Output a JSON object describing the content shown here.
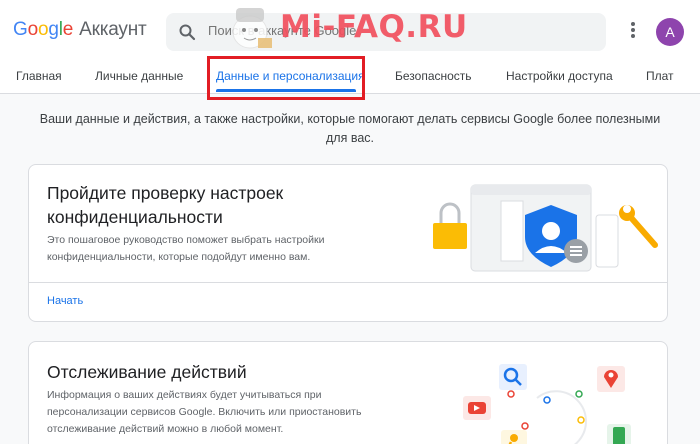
{
  "header": {
    "logo_letters": [
      "G",
      "o",
      "o",
      "g",
      "l",
      "e"
    ],
    "product": "Аккаунт",
    "search_placeholder": "Поиск в аккаунте Google",
    "avatar_letter": "A",
    "watermark_text": "Mi-FAQ.RU"
  },
  "tabs": [
    {
      "label": "Главная",
      "active": false
    },
    {
      "label": "Личные данные",
      "active": false
    },
    {
      "label": "Данные и персонализация",
      "active": true
    },
    {
      "label": "Безопасность",
      "active": false
    },
    {
      "label": "Настройки доступа",
      "active": false
    },
    {
      "label": "Плат",
      "active": false
    }
  ],
  "intro": "Ваши данные и действия, а также настройки, которые помогают делать сервисы Google более полезными для вас.",
  "privacy_card": {
    "title": "Пройдите проверку настроек конфиденциальности",
    "description": "Это пошаговое руководство поможет выбрать настройки конфиденциальности, которые подойдут именно вам.",
    "link": "Начать"
  },
  "activity_card": {
    "title": "Отслеживание действий",
    "description": "Информация о ваших действиях будет учитываться при персонализации сервисов Google. Включить или приостановить отслеживание действий можно в любой момент."
  },
  "colors": {
    "accent": "#1a73e8",
    "highlight_box": "#e21d24",
    "avatar": "#8e44ad",
    "watermark": "#f1505e"
  }
}
